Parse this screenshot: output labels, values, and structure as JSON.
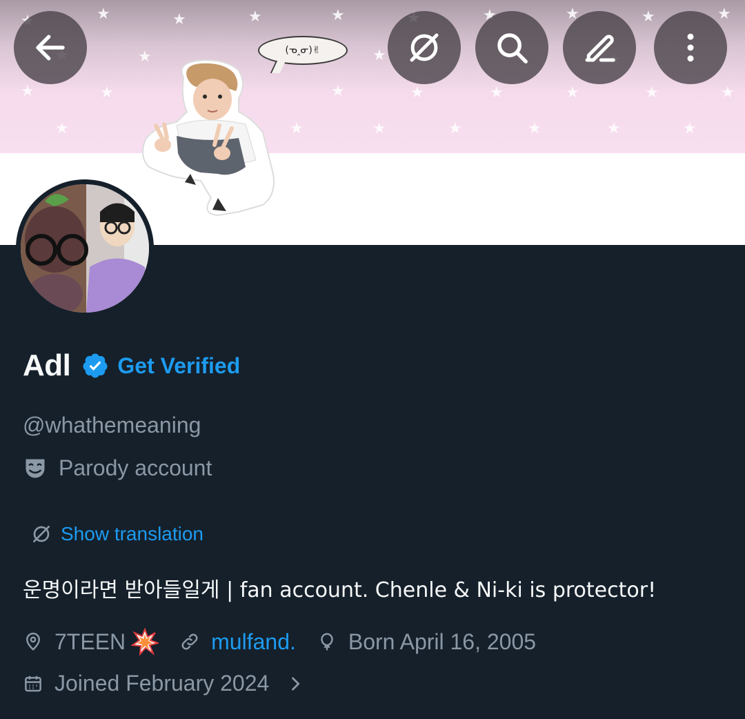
{
  "banner": {
    "speech_text": "(ᓀ‸ᓂ)✌"
  },
  "actions": {
    "back": "back-arrow-icon",
    "translate_toggle": "no-translate-icon",
    "search": "search-icon",
    "edit": "pencil-icon",
    "more": "more-vertical-icon"
  },
  "profile": {
    "display_name": "Adl",
    "get_verified_label": "Get Verified",
    "handle": "@whathemeaning",
    "parody_label": "Parody account",
    "show_translation_label": "Show translation",
    "bio": "운명이라면 받아들일게 | fan account. Chenle & Ni-ki is protector!",
    "location": "7TEEN",
    "website": "mulfand.",
    "birthday": "Born April 16, 2005",
    "joined": "Joined February 2024"
  },
  "colors": {
    "background": "#15202b",
    "accent": "#1d9bf0",
    "muted_text": "#8b98a5",
    "primary_text": "#f7f9f9"
  }
}
